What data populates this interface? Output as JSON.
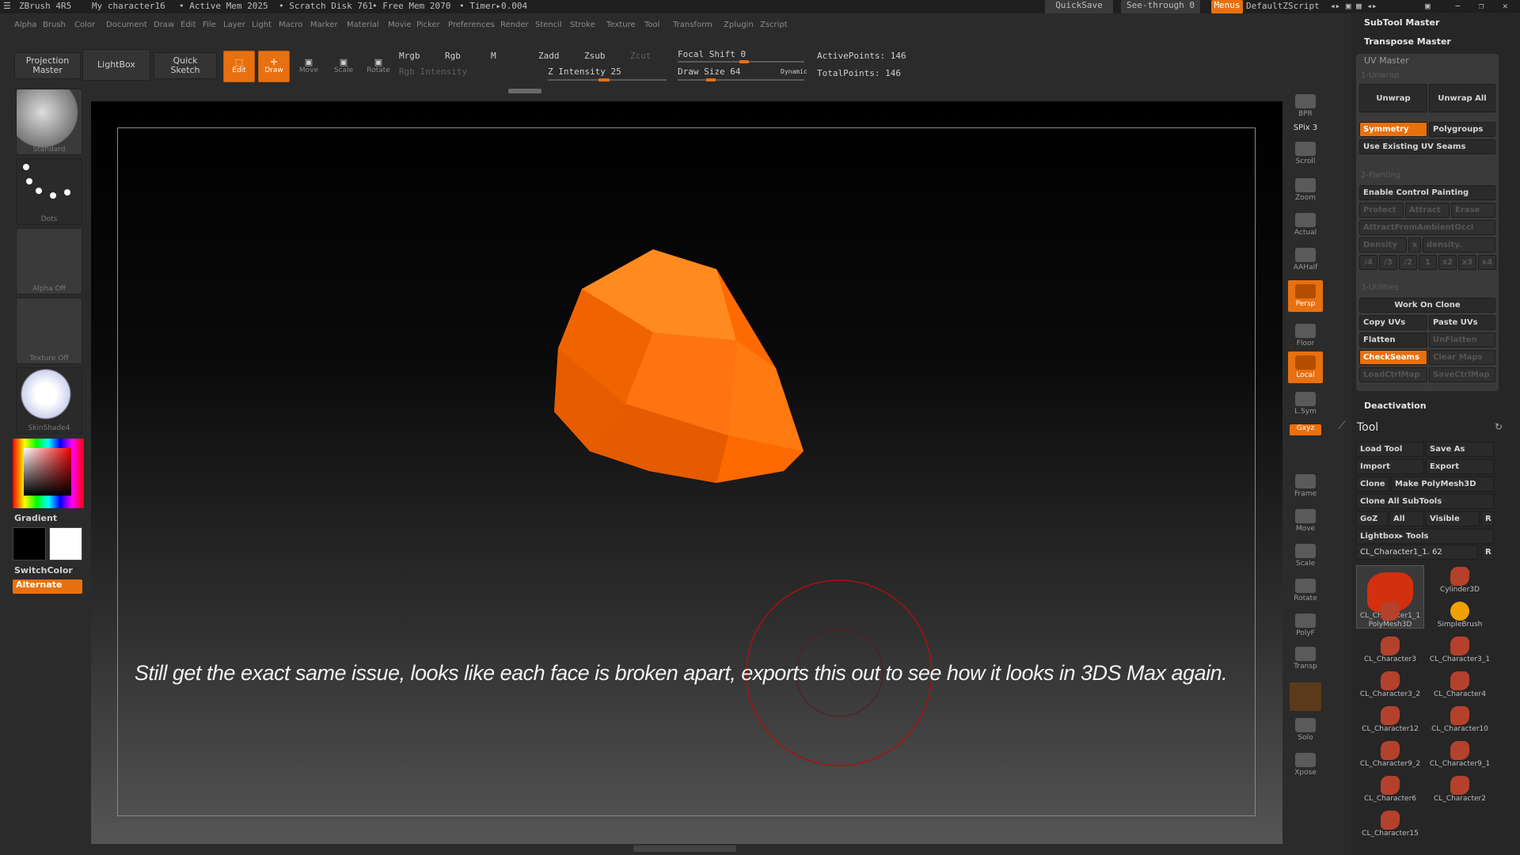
{
  "titlebar": {
    "app": "ZBrush 4R5",
    "doc": "My character16",
    "active_mem": "• Active Mem 2025",
    "scratch": "• Scratch Disk 761",
    "free_mem": "• Free Mem 2070",
    "timer": "• Timer▸0.004",
    "quicksave": "QuickSave",
    "seethrough": "See-through   0",
    "menus": "Menus",
    "script": "DefaultZScript"
  },
  "menubar": [
    "Alpha",
    "Brush",
    "Color",
    "Document",
    "Draw",
    "Edit",
    "File",
    "Layer",
    "Light",
    "Macro",
    "Marker",
    "Material",
    "Movie",
    "Picker",
    "Preferences",
    "Render",
    "Stencil",
    "Stroke",
    "Texture",
    "Tool",
    "Transform",
    "Zplugin",
    "Zscript"
  ],
  "toolbar": {
    "projection_master": "Projection\nMaster",
    "lightbox": "LightBox",
    "quick_sketch": "Quick\nSketch",
    "edit": "Edit",
    "draw": "Draw",
    "move": "Move",
    "scale": "Scale",
    "rotate": "Rotate",
    "mrgb": "Mrgb",
    "rgb": "Rgb",
    "m": "M",
    "rgb_intensity": "Rgb Intensity",
    "zadd": "Zadd",
    "zsub": "Zsub",
    "zcut": "Zcut",
    "z_intensity": "Z Intensity 25",
    "focal_shift": "Focal Shift 0",
    "draw_size": "Draw Size 64",
    "dynamic": "Dynamic",
    "active_points": "ActivePoints: 146",
    "total_points": "TotalPoints: 146"
  },
  "left": {
    "brush": "Standard",
    "stroke": "Dots",
    "alpha": "Alpha Off",
    "texture": "Texture Off",
    "material": "SkinShade4",
    "gradient": "Gradient",
    "switchcolor": "SwitchColor",
    "alternate": "Alternate"
  },
  "caption": "Still get the exact same issue, looks like each face is broken apart, exports this out to see how it looks in 3DS Max again.",
  "rightbar": {
    "bpr": "BPR",
    "spix": "SPix 3",
    "scroll": "Scroll",
    "zoom": "Zoom",
    "actual": "Actual",
    "aahalf": "AAHalf",
    "persp": "Persp",
    "floor": "Floor",
    "local": "Local",
    "lsym": "L.Sym",
    "xyz": "Gxyz",
    "frame": "Frame",
    "move": "Move",
    "scale": "Scale",
    "rotate": "Rotate",
    "polyf": "PolyF",
    "transp": "Transp",
    "solo": "Solo",
    "xpose": "Xpose"
  },
  "panel": {
    "subtool_master": "SubTool Master",
    "transpose_master": "Transpose Master",
    "uv_master": "UV Master",
    "unwrap_sec": "1-Unwrap",
    "unwrap": "Unwrap",
    "unwrap_all": "Unwrap All",
    "symmetry": "Symmetry",
    "polygroups": "Polygroups",
    "use_existing": "Use Existing UV Seams",
    "painting_sec": "2-Painting",
    "enable_cp": "Enable Control Painting",
    "protect": "Protect",
    "attract": "Attract",
    "erase": "Erase",
    "attract_ao": "AttractFromAmbientOccl",
    "density": "Density",
    "x": "x",
    "density2": "density.",
    "d_vals": [
      "/4",
      "/3",
      "/2",
      "1",
      "x2",
      "x3",
      "x4"
    ],
    "utilities_sec": "3-Utilities",
    "work_on_clone": "Work On Clone",
    "copy_uvs": "Copy UVs",
    "paste_uvs": "Paste UVs",
    "flatten": "Flatten",
    "unflatten": "UnFlatten",
    "checkseams": "CheckSeams",
    "clear_maps": "Clear Maps",
    "loadctrlmap": "LoadCtrlMap",
    "savectrlmap": "SaveCtrlMap",
    "deactivation": "Deactivation"
  },
  "tool": {
    "title": "Tool",
    "load_tool": "Load Tool",
    "save_as": "Save As",
    "import": "Import",
    "export": "Export",
    "clone": "Clone",
    "make_polymesh": "Make PolyMesh3D",
    "clone_all": "Clone All SubTools",
    "goz": "GoZ",
    "all": "All",
    "visible": "Visible",
    "r": "R",
    "lightbox_tools": "Lightbox▸ Tools",
    "current": "CL_Character1_1. 62",
    "thumbs": [
      "CL_Character1_1",
      "Cylinder3D",
      "PolyMesh3D",
      "SimpleBrush",
      "CL_Character3",
      "CL_Character3_1",
      "CL_Character3_2",
      "CL_Character4",
      "CL_Character12",
      "CL_Character10",
      "CL_Character9_2",
      "CL_Character9_1",
      "CL_Character6",
      "CL_Character2",
      "CL_Character15"
    ]
  },
  "colors": {
    "accent": "#e8700f",
    "bg": "#2b2b2b",
    "mesh": "#ff6a00"
  }
}
